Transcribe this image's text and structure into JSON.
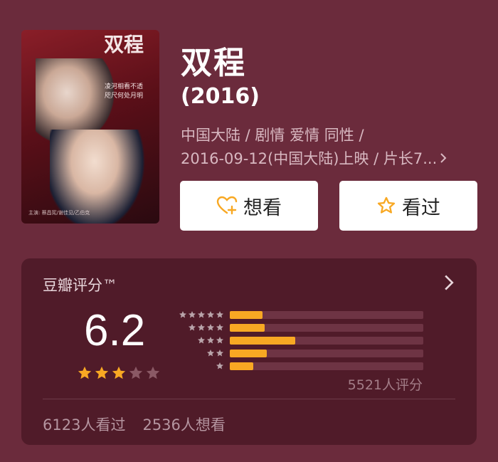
{
  "movie": {
    "title": "双程",
    "year": "(2016)",
    "meta_line1": "中国大陆 / 剧情 爱情 同性 /",
    "meta_line2": "2016-09-12(中国大陆)上映 / 片长7...",
    "poster": {
      "title": "双程",
      "subtitle": "凌河相看不透\n咫尺何处月明",
      "credits": "主演: 蔡昌宪/谢佳见/乙伯克"
    }
  },
  "actions": {
    "want_label": "想看",
    "seen_label": "看过"
  },
  "rating": {
    "header": "豆瓣评分™",
    "score": "6.2",
    "star_value": 3,
    "star_total": 5,
    "distribution": [
      {
        "stars": 5,
        "percent": 17
      },
      {
        "stars": 4,
        "percent": 18
      },
      {
        "stars": 3,
        "percent": 34
      },
      {
        "stars": 2,
        "percent": 19
      },
      {
        "stars": 1,
        "percent": 12
      }
    ],
    "count_text": "5521人评分",
    "seen_count": "6123人看过",
    "want_count": "2536人想看"
  },
  "colors": {
    "background": "#6b2b3c",
    "card": "#501b29",
    "accent": "#f8a823"
  }
}
